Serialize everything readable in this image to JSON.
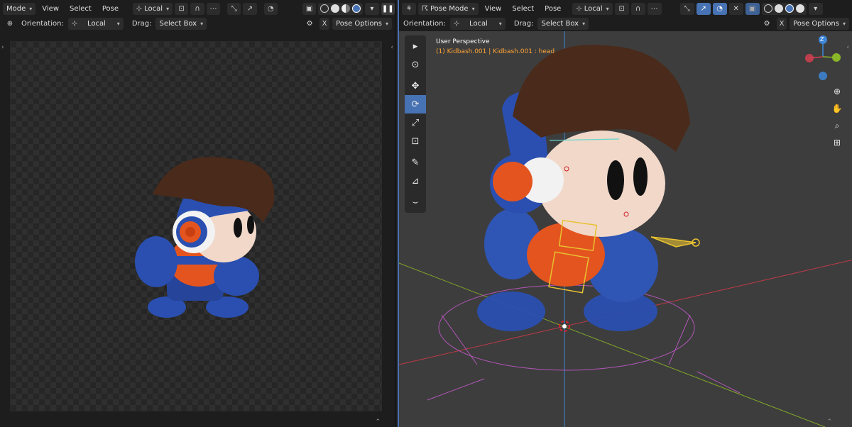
{
  "left_editor": {
    "header": {
      "mode": "Mode",
      "menus": [
        "View",
        "Select",
        "Pose"
      ],
      "transform_space": "Local"
    },
    "tool_header": {
      "orientation_label": "Orientation:",
      "orientation_value": "Local",
      "drag_label": "Drag:",
      "drag_value": "Select Box",
      "x_label": "X",
      "pose_options": "Pose Options"
    }
  },
  "right_editor": {
    "header": {
      "mode": "Pose Mode",
      "menus": [
        "View",
        "Select",
        "Pose"
      ],
      "transform_space": "Local"
    },
    "tool_header": {
      "orientation_label": "Orientation:",
      "orientation_value": "Local",
      "drag_label": "Drag:",
      "drag_value": "Select Box",
      "x_label": "X",
      "pose_options": "Pose Options"
    },
    "viewport": {
      "view_name": "User Perspective",
      "object_info": "(1) Kidbash.001 | Kidbash.001 : head"
    },
    "gizmo": {
      "z_label": "Z"
    }
  },
  "colors": {
    "accent": "#4772b3",
    "x_axis": "#d34050",
    "y_axis": "#8ab728",
    "z_axis": "#3d86d8",
    "info_text": "#ffa436",
    "bone_selected": "#e8c230",
    "character_blue": "#2a4fb0",
    "character_orange": "#e4541f",
    "hair_brown": "#4a2a1a"
  },
  "icons": [
    "mode-icon",
    "view-menu",
    "snap-icon",
    "proportional-icon",
    "overlay-icon",
    "xray-icon",
    "shading-icons",
    "pause-icon",
    "select-box-tool",
    "cursor-tool",
    "move-tool",
    "rotate-tool",
    "scale-tool",
    "transform-tool",
    "annotate-tool",
    "measure-tool",
    "relax-tool",
    "zoom-icon",
    "hand-icon",
    "camera-icon",
    "grid-icon"
  ]
}
